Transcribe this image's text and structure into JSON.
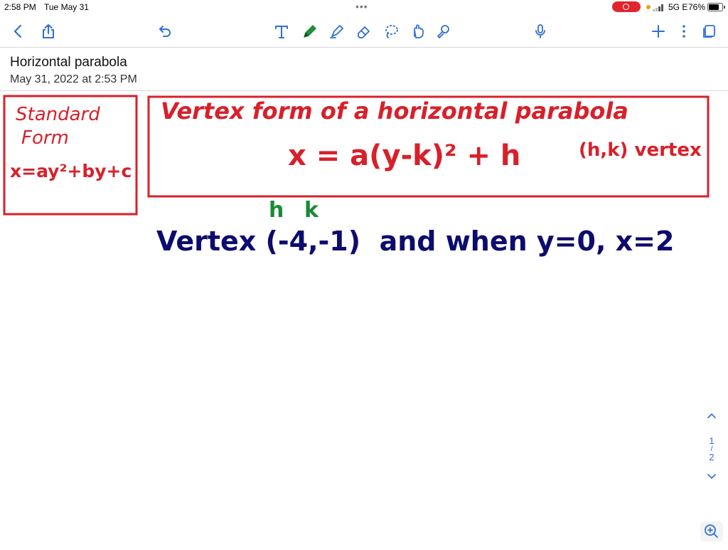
{
  "status_bar": {
    "time": "2:58 PM",
    "date": "Tue May 31",
    "network": "5G E",
    "battery": "76%"
  },
  "toolbar": {
    "icons": [
      "back-icon",
      "share-icon",
      "undo-icon",
      "text-tool-icon",
      "pen-icon",
      "highlighter-icon",
      "eraser-icon",
      "lasso-icon",
      "shapes-icon",
      "laser-icon",
      "microphone-icon",
      "add-page-icon",
      "more-icon",
      "pages-icon"
    ],
    "colors": {
      "accent": "#2f6fd6",
      "active_pen": "#1f8f3a"
    }
  },
  "note": {
    "title": "Horizontal parabola",
    "date": "May 31, 2022 at 2:53 PM"
  },
  "page_nav": {
    "current": "1",
    "separator": "/",
    "total": "2"
  },
  "ink": {
    "colors": {
      "red": "#d8202a",
      "navy": "#0d0b6e",
      "green": "#1a8a35"
    },
    "left_box": {
      "line1": "Standard",
      "line2": "Form",
      "line3": "x=ay²+by+c"
    },
    "right_box": {
      "line1": "Vertex form of a horizontal parabola",
      "formula": "x = a(y-k)² + h",
      "note": "(h,k) vertex"
    },
    "labels": {
      "h": "h",
      "k": "k"
    },
    "line": "Vertex (-4,-1)  and when y=0, x=2"
  }
}
